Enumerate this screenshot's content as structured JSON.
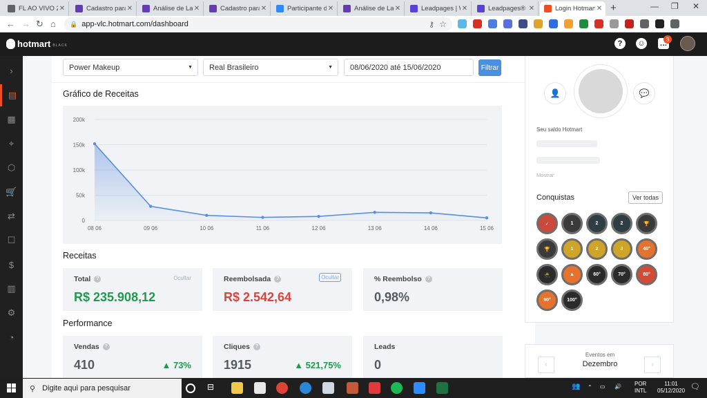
{
  "browser": {
    "tabs": [
      {
        "title": "FL AO VIVO 20",
        "favicon": "#5f6368"
      },
      {
        "title": "Cadastro para",
        "favicon": "#673ab7"
      },
      {
        "title": "Análise de Lan",
        "favicon": "#673ab7"
      },
      {
        "title": "Cadastro para",
        "favicon": "#673ab7"
      },
      {
        "title": "Participante do",
        "favicon": "#2d8cff"
      },
      {
        "title": "Análise de Lan",
        "favicon": "#673ab7"
      },
      {
        "title": "Leadpages | W",
        "favicon": "#5b3fd9"
      },
      {
        "title": "Leadpages® -",
        "favicon": "#5b3fd9"
      },
      {
        "title": "Login Hotmart",
        "favicon": "#ef4e23"
      }
    ],
    "url": "app-vlc.hotmart.com/dashboard"
  },
  "app": {
    "logo": "hotmart",
    "logo_sub": "BLACK",
    "notif_count": "3",
    "accent": "#ef4e23"
  },
  "filters": {
    "product": "Power Makeup",
    "currency": "Real Brasileiro",
    "date_range": "08/06/2020 até 15/06/2020",
    "button": "Filtrar"
  },
  "revenue_chart": {
    "title": "Gráfico de Receitas"
  },
  "chart_data": {
    "type": "line",
    "title": "Gráfico de Receitas",
    "categories": [
      "08 06",
      "09 06",
      "10 06",
      "11 06",
      "12 06",
      "13 06",
      "14 06",
      "15 06"
    ],
    "values": [
      152000,
      28000,
      10000,
      6000,
      8000,
      16000,
      15000,
      5000
    ],
    "yticks": [
      "0",
      "50k",
      "100k",
      "150k",
      "200k"
    ],
    "ylim": [
      0,
      200000
    ],
    "grid": true,
    "color": "#5b8fde"
  },
  "receitas": {
    "title": "Receitas",
    "cards": [
      {
        "label": "Total",
        "value": "R$ 235.908,12",
        "hide": "Ocultar",
        "color": "#1f9a4f"
      },
      {
        "label": "Reembolsada",
        "value": "R$ 2.542,64",
        "hide": "Ocultar",
        "color": "#d9453d"
      },
      {
        "label": "% Reembolso",
        "value": "0,98%",
        "color": "#555a60"
      }
    ]
  },
  "performance": {
    "title": "Performance",
    "cards": [
      {
        "label": "Vendas",
        "value": "410",
        "change": "73%"
      },
      {
        "label": "Cliques",
        "value": "1915",
        "change": "521,75%"
      },
      {
        "label": "Leads",
        "value": "0"
      }
    ]
  },
  "profile": {
    "saldo_label": "Seu saldo Hotmart",
    "show": "Mostrar",
    "conquistas": "Conquistas",
    "ver_todas": "Ver todas"
  },
  "medals": [
    {
      "label": "✓",
      "color": "#c94a3a"
    },
    {
      "label": "1",
      "color": "#3a3a3a"
    },
    {
      "label": "2",
      "color": "#2f3d44"
    },
    {
      "label": "2",
      "color": "#2f3d44"
    },
    {
      "label": "🏆",
      "color": "#3a3a3a"
    },
    {
      "label": "🏆",
      "color": "#3a3a3a"
    },
    {
      "label": "1",
      "color": "#cfa529"
    },
    {
      "label": "2",
      "color": "#cfa529"
    },
    {
      "label": "3",
      "color": "#cfa529"
    },
    {
      "label": "40°",
      "color": "#e5722d"
    },
    {
      "label": "🥷",
      "color": "#2b2b2b"
    },
    {
      "label": "▲",
      "color": "#e5722d"
    },
    {
      "label": "60°",
      "color": "#2b2b2b"
    },
    {
      "label": "70°",
      "color": "#2b2b2b"
    },
    {
      "label": "80°",
      "color": "#d44b35"
    },
    {
      "label": "90°",
      "color": "#e5722d"
    },
    {
      "label": "100°",
      "color": "#2b2b2b"
    }
  ],
  "events": {
    "label": "Eventos em",
    "month": "Dezembro"
  },
  "taskbar": {
    "search": "Digite aqui para pesquisar",
    "lang1": "POR",
    "lang2": "INTL",
    "time": "11:01",
    "date": "05/12/2020"
  }
}
